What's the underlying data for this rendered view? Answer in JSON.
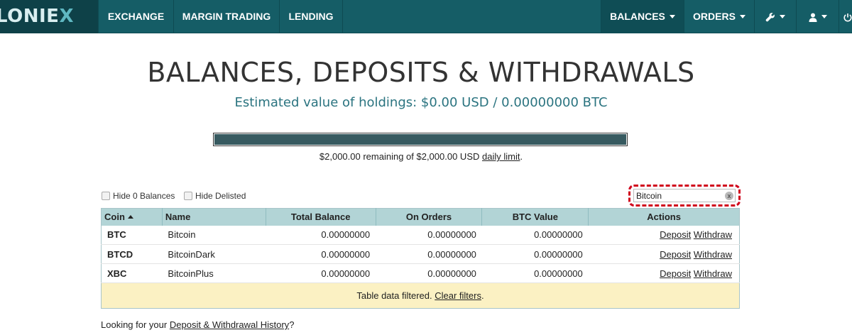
{
  "logo": {
    "text_main": "LONIE",
    "text_x": "X"
  },
  "nav": {
    "exchange": "EXCHANGE",
    "margin_trading": "MARGIN TRADING",
    "lending": "LENDING",
    "balances": "BALANCES",
    "orders": "ORDERS"
  },
  "page": {
    "title": "BALANCES, DEPOSITS & WITHDRAWALS",
    "estimated": "Estimated value of holdings: $0.00 USD / 0.00000000 BTC"
  },
  "limit": {
    "text": "$2,000.00 remaining of $2,000.00 USD",
    "link": "daily limit",
    "suffix": ".",
    "remaining_fraction": 1.0
  },
  "filters": {
    "hide_zero": "Hide 0 Balances",
    "hide_delisted": "Hide Delisted",
    "search_value": "Bitcoin",
    "clear_label": "x"
  },
  "table": {
    "headers": {
      "coin": "Coin",
      "name": "Name",
      "total": "Total Balance",
      "orders": "On Orders",
      "btc": "BTC Value",
      "actions": "Actions"
    },
    "rows": [
      {
        "coin": "BTC",
        "name": "Bitcoin",
        "total": "0.00000000",
        "orders": "0.00000000",
        "btc": "0.00000000",
        "deposit": "Deposit",
        "withdraw": "Withdraw"
      },
      {
        "coin": "BTCD",
        "name": "BitcoinDark",
        "total": "0.00000000",
        "orders": "0.00000000",
        "btc": "0.00000000",
        "deposit": "Deposit",
        "withdraw": "Withdraw"
      },
      {
        "coin": "XBC",
        "name": "BitcoinPlus",
        "total": "0.00000000",
        "orders": "0.00000000",
        "btc": "0.00000000",
        "deposit": "Deposit",
        "withdraw": "Withdraw"
      }
    ],
    "filtered_text": "Table data filtered.",
    "clear_filters": "Clear filters",
    "filtered_suffix": "."
  },
  "history": {
    "prefix": "Looking for your",
    "link": "Deposit & Withdrawal History",
    "suffix": "?"
  },
  "colors": {
    "nav_bg": "#155d66",
    "accent_text": "#2b7480",
    "table_header": "#b2d4d6",
    "filtered_bg": "#fbf1c3",
    "highlight": "#d0021b"
  },
  "icons": [
    "wrench-icon",
    "user-icon",
    "power-icon",
    "sort-ascending-icon",
    "clear-search-icon"
  ]
}
